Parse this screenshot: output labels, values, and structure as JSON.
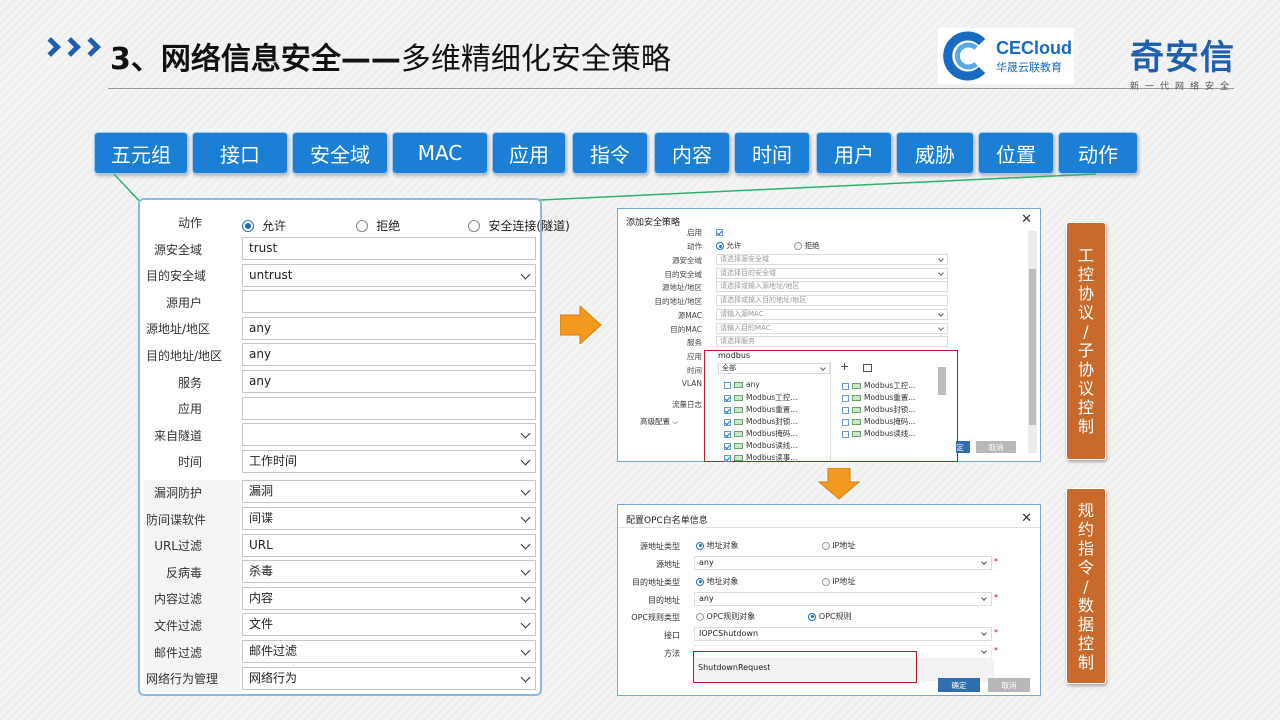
{
  "header": {
    "title_bold": "3、网络信息安全——",
    "title_light": "多维精细化安全策略"
  },
  "logos": {
    "cecloud_en": "CECloud",
    "cecloud_cn": "华晟云联教育",
    "qax_big": "奇安信",
    "qax_small": "新一代网络安全"
  },
  "tabs": [
    "五元组",
    "接口",
    "安全域",
    "MAC",
    "应用",
    "指令",
    "内容",
    "时间",
    "用户",
    "威胁",
    "位置",
    "动作"
  ],
  "policy_form": {
    "action_label": "动作",
    "action_options": [
      "允许",
      "拒绝",
      "安全连接(隧道)"
    ],
    "rows": [
      {
        "label": "源安全域",
        "value": "trust",
        "dropdown": false
      },
      {
        "label": "目的安全域",
        "value": "untrust",
        "dropdown": true
      },
      {
        "label": "源用户",
        "value": "",
        "dropdown": false
      },
      {
        "label": "源地址/地区",
        "value": "any",
        "dropdown": false
      },
      {
        "label": "目的地址/地区",
        "value": "any",
        "dropdown": false
      },
      {
        "label": "服务",
        "value": "any",
        "dropdown": false
      },
      {
        "label": "应用",
        "value": "",
        "dropdown": false
      },
      {
        "label": "来自隧道",
        "value": "",
        "dropdown": true
      },
      {
        "label": "时间",
        "value": "工作时间",
        "dropdown": true
      },
      {
        "label": "漏洞防护",
        "value": "漏洞",
        "dropdown": true
      },
      {
        "label": "防间谍软件",
        "value": "间谍",
        "dropdown": true
      },
      {
        "label": "URL过滤",
        "value": "URL",
        "dropdown": true
      },
      {
        "label": "反病毒",
        "value": "杀毒",
        "dropdown": true
      },
      {
        "label": "内容过滤",
        "value": "内容",
        "dropdown": true
      },
      {
        "label": "文件过滤",
        "value": "文件",
        "dropdown": true
      },
      {
        "label": "邮件过滤",
        "value": "邮件过滤",
        "dropdown": true
      },
      {
        "label": "网络行为管理",
        "value": "网络行为",
        "dropdown": true
      }
    ]
  },
  "dialog_add": {
    "title": "添加安全策略",
    "enable_label": "启用",
    "action_label": "动作",
    "allow": "允许",
    "deny": "拒绝",
    "rows": [
      {
        "label": "源安全域",
        "placeholder": "请选择源安全域",
        "dropdown": true
      },
      {
        "label": "目的安全域",
        "placeholder": "请选择目的安全域",
        "dropdown": true
      },
      {
        "label": "源地址/地区",
        "placeholder": "请选择或输入源地址/地区",
        "dropdown": false
      },
      {
        "label": "目的地址/地区",
        "placeholder": "请选择或输入目的地址/地区",
        "dropdown": false
      },
      {
        "label": "源MAC",
        "placeholder": "请输入源MAC",
        "dropdown": true
      },
      {
        "label": "目的MAC",
        "placeholder": "请输入目的MAC",
        "dropdown": true
      },
      {
        "label": "服务",
        "placeholder": "请选择服务",
        "dropdown": false
      }
    ],
    "app_label": "应用",
    "app_value": "modbus",
    "time_label": "时间",
    "vlan_label": "VLAN",
    "log_label": "流量日志",
    "advanced_label": "高级配置",
    "filter_all": "全部",
    "left_list": [
      "any",
      "Modbus工控...",
      "Modbus重置...",
      "Modbus封锁...",
      "Modbus掩码...",
      "Modbus读线...",
      "Modbus读事..."
    ],
    "left_checked": [
      false,
      true,
      true,
      true,
      true,
      true,
      true
    ],
    "right_list": [
      "Modbus工控...",
      "Modbus重置...",
      "Modbus封锁...",
      "Modbus掩码...",
      "Modbus读线..."
    ],
    "confirm": "确定",
    "cancel": "取消"
  },
  "dialog_opc": {
    "title": "配置OPC白名单信息",
    "src_type_label": "源地址类型",
    "src_label": "源地址",
    "dst_type_label": "目的地址类型",
    "dst_label": "目的地址",
    "rule_type_label": "OPC规则类型",
    "iface_label": "接口",
    "method_label": "方法",
    "addr_obj": "地址对象",
    "ip_addr": "IP地址",
    "opc_obj": "OPC规则对象",
    "opc_rule": "OPC规则",
    "src_value": "any",
    "dst_value": "any",
    "iface_value": "IOPCShutdown",
    "method_value": "ShutdownRequest",
    "star": "*",
    "confirm": "确定",
    "cancel": "取消"
  },
  "side_labels": {
    "top": [
      "工",
      "控",
      "协",
      "议",
      "/",
      "子",
      "协",
      "议",
      "控",
      "制"
    ],
    "bottom": [
      "规",
      "约",
      "指",
      "令",
      "/",
      "数",
      "据",
      "控",
      "制"
    ]
  },
  "colors": {
    "tab_blue": "#1b7fd6",
    "side_orange": "#c86a2b",
    "arrow_orange": "#f39a1e",
    "connector_green": "#2bb36b",
    "highlight_red": "#b51d2a"
  }
}
